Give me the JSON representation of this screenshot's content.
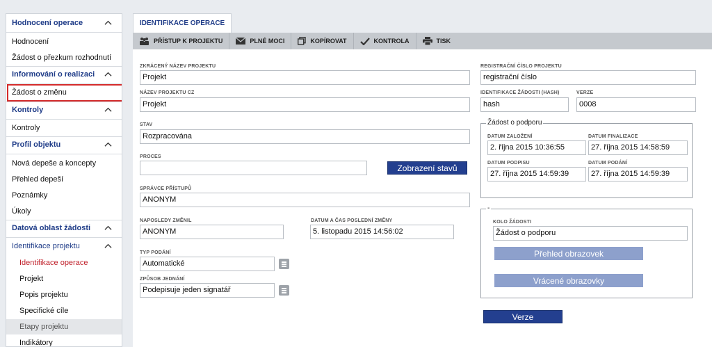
{
  "sidebar": {
    "sections": [
      {
        "title": "Hodnocení operace",
        "items": [
          "Hodnocení",
          "Žádost o přezkum rozhodnutí"
        ]
      },
      {
        "title": "Informování o realizaci",
        "items": [
          "Žádost o změnu"
        ]
      },
      {
        "title": "Kontroly",
        "items": [
          "Kontroly"
        ]
      },
      {
        "title": "Profil objektu",
        "items": [
          "Nová depeše a koncepty",
          "Přehled depeší",
          "Poznámky",
          "Úkoly"
        ]
      },
      {
        "title": "Datová oblast žádosti",
        "items": []
      },
      {
        "title": "Identifikace projektu",
        "items": [
          "Identifikace operace",
          "Projekt",
          "Popis projektu",
          "Specifické cíle",
          "Etapy projektu",
          "Indikátory"
        ]
      }
    ]
  },
  "tab": {
    "label": "IDENTIFIKACE OPERACE"
  },
  "toolbar": {
    "items": [
      {
        "label": "PŘÍSTUP K PROJEKTU",
        "icon": "people-icon"
      },
      {
        "label": "PLNÉ MOCI",
        "icon": "envelope-icon"
      },
      {
        "label": "KOPÍROVAT",
        "icon": "copy-icon"
      },
      {
        "label": "KONTROLA",
        "icon": "checkmark-icon"
      },
      {
        "label": "TISK",
        "icon": "printer-icon"
      }
    ]
  },
  "form": {
    "short_name_label": "ZKRÁCENÝ NÁZEV PROJEKTU",
    "short_name_value": "Projekt",
    "name_cz_label": "NÁZEV PROJEKTU CZ",
    "name_cz_value": "Projekt",
    "state_label": "STAV",
    "state_value": "Rozpracována",
    "process_label": "PROCES",
    "process_value": "",
    "show_states_button": "Zobrazení stavů",
    "access_admin_label": "SPRÁVCE PŘÍSTUPŮ",
    "access_admin_value": "ANONYM",
    "last_changed_by_label": "NAPOSLEDY ZMĚNIL",
    "last_changed_by_value": "ANONYM",
    "last_change_date_label": "DATUM A ČAS POSLEDNÍ ZMĚNY",
    "last_change_date_value": "5. listopadu 2015 14:56:02",
    "submission_type_label": "TYP PODÁNÍ",
    "submission_type_value": "Automatické",
    "acting_method_label": "ZPŮSOB JEDNÁNÍ",
    "acting_method_value": "Podepisuje jeden signatář",
    "reg_number_label": "REGISTRAČNÍ ČÍSLO PROJEKTU",
    "reg_number_value": "registrační číslo",
    "hash_label": "IDENTIFIKACE ŽÁDOSTI (HASH)",
    "hash_value": "hash",
    "version_label": "VERZE",
    "version_value": "0008"
  },
  "support": {
    "legend": "Žádost o podporu",
    "created_label": "DATUM ZALOŽENÍ",
    "created_value": "2. října 2015 10:36:55",
    "finalized_label": "DATUM FINALIZACE",
    "finalized_value": "27. října 2015 14:58:59",
    "signed_label": "DATUM PODPISU",
    "signed_value": "27. října 2015 14:59:39",
    "submitted_label": "DATUM PODÁNÍ",
    "submitted_value": "27. října 2015 14:59:39"
  },
  "round": {
    "legend": "-",
    "label": "KOLO ŽÁDOSTI",
    "value": "Žádost o podporu",
    "overview_button": "Přehled obrazovek",
    "returned_button": "Vrácené obrazovky"
  },
  "versions_button": "Verze",
  "colors": {
    "accent": "#1f3c88",
    "button": "#233f8f",
    "active": "#c0212b",
    "highlight": "#d42b2b"
  }
}
